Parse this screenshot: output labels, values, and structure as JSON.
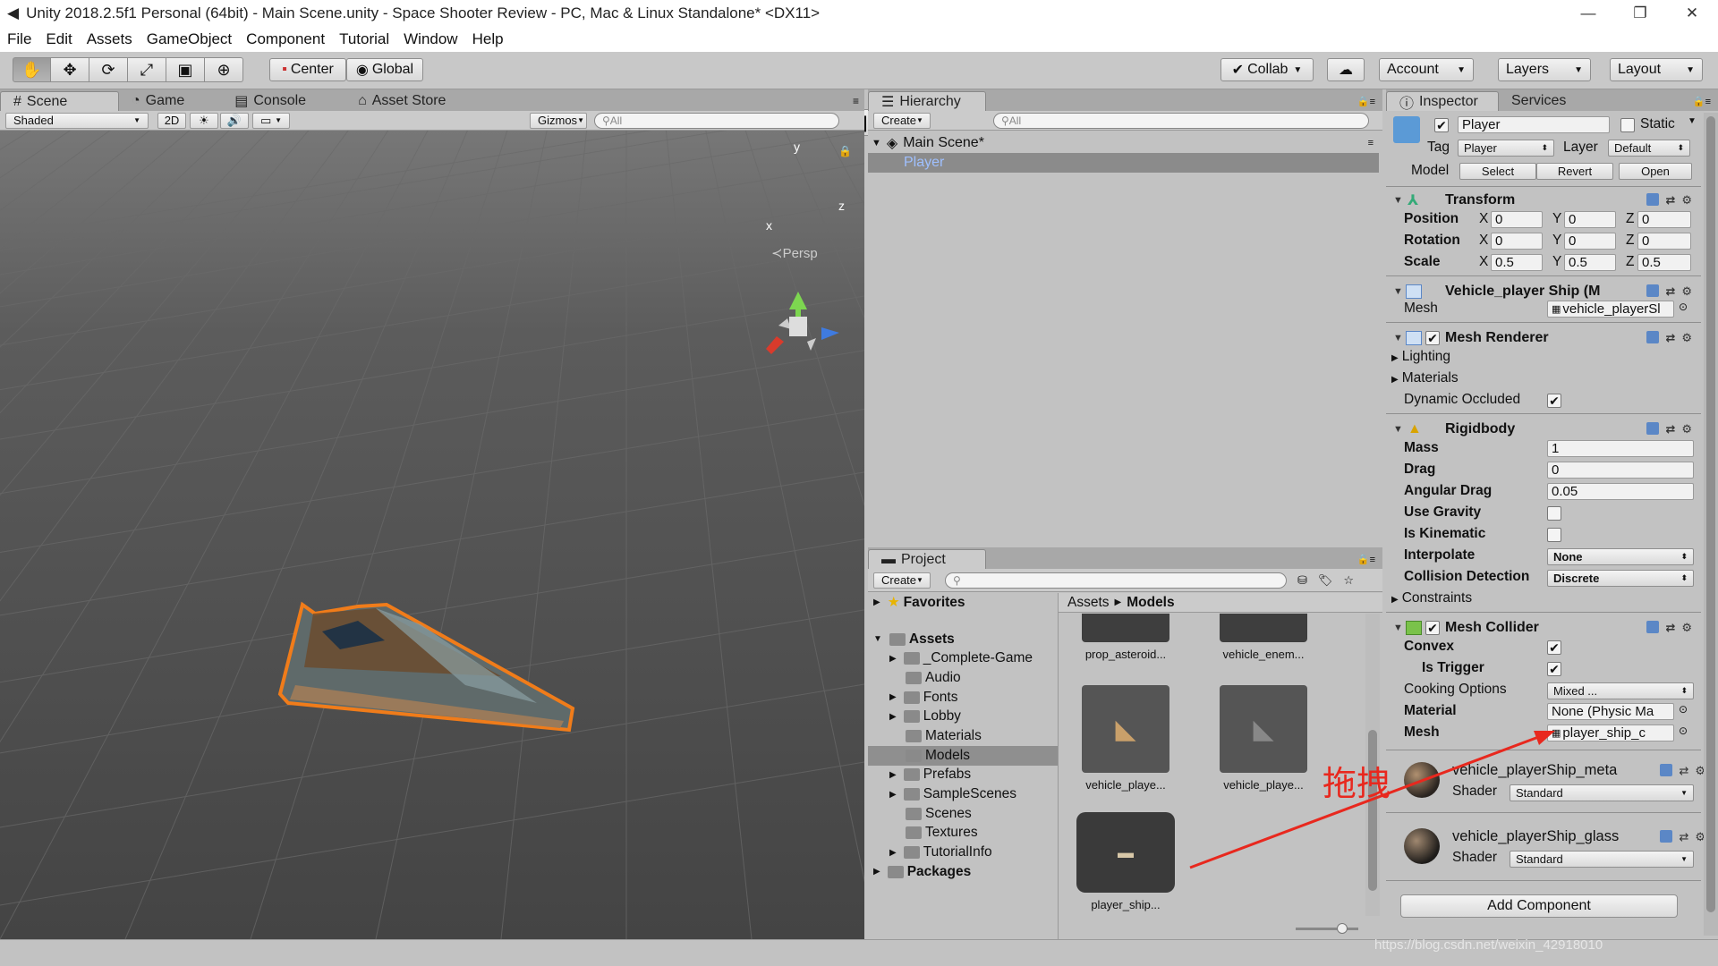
{
  "window": {
    "title": "Unity 2018.2.5f1 Personal (64bit) - Main Scene.unity - Space Shooter Review - PC, Mac & Linux Standalone* <DX11>",
    "controls": [
      "—",
      "❐",
      "✕"
    ]
  },
  "menu": [
    "File",
    "Edit",
    "Assets",
    "GameObject",
    "Component",
    "Tutorial",
    "Window",
    "Help"
  ],
  "toolbar": {
    "pivot": "Center",
    "space": "Global",
    "collab": "Collab",
    "account": "Account",
    "layers": "Layers",
    "layout": "Layout"
  },
  "scene": {
    "tabs": [
      "Scene",
      "Game",
      "Console",
      "Asset Store"
    ],
    "shading": "Shaded",
    "mode_2d": "2D",
    "gizmos": "Gizmos",
    "search_placeholder": "All",
    "gizmo_labels": {
      "y": "y",
      "x": "x",
      "z": "z"
    },
    "persp": "Persp"
  },
  "hierarchy": {
    "tab": "Hierarchy",
    "create": "Create",
    "search_placeholder": "All",
    "scene_name": "Main Scene*",
    "items": [
      "Player"
    ]
  },
  "project": {
    "tab": "Project",
    "create": "Create",
    "favorites": "Favorites",
    "assets_root": "Assets",
    "folders": [
      "_Complete-Game",
      "Audio",
      "Fonts",
      "Lobby",
      "Materials",
      "Models",
      "Prefabs",
      "SampleScenes",
      "Scenes",
      "Textures",
      "TutorialInfo"
    ],
    "packages": "Packages",
    "breadcrumb": [
      "Assets",
      "Models"
    ],
    "assets": [
      "prop_asteroid...",
      "vehicle_enem...",
      "vehicle_playe...",
      "vehicle_playe...",
      "player_ship..."
    ]
  },
  "inspector": {
    "tabs": [
      "Inspector",
      "Services"
    ],
    "object_name": "Player",
    "static_label": "Static",
    "tag_label": "Tag",
    "tag_value": "Player",
    "layer_label": "Layer",
    "layer_value": "Default",
    "model_label": "Model",
    "model_buttons": [
      "Select",
      "Revert",
      "Open"
    ],
    "transform": {
      "title": "Transform",
      "rows": [
        {
          "label": "Position",
          "x": "0",
          "y": "0",
          "z": "0"
        },
        {
          "label": "Rotation",
          "x": "0",
          "y": "0",
          "z": "0"
        },
        {
          "label": "Scale",
          "x": "0.5",
          "y": "0.5",
          "z": "0.5"
        }
      ]
    },
    "mesh_filter": {
      "title": "Vehicle_player Ship (M",
      "mesh_label": "Mesh",
      "mesh_value": "vehicle_playerSl"
    },
    "mesh_renderer": {
      "title": "Mesh Renderer",
      "lighting": "Lighting",
      "materials": "Materials",
      "dynamic_occluded": "Dynamic Occluded"
    },
    "rigidbody": {
      "title": "Rigidbody",
      "mass_label": "Mass",
      "mass": "1",
      "drag_label": "Drag",
      "drag": "0",
      "angular_label": "Angular Drag",
      "angular": "0.05",
      "gravity_label": "Use Gravity",
      "kinematic_label": "Is Kinematic",
      "interpolate_label": "Interpolate",
      "interpolate": "None",
      "collision_label": "Collision Detection",
      "collision": "Discrete",
      "constraints": "Constraints"
    },
    "mesh_collider": {
      "title": "Mesh Collider",
      "convex_label": "Convex",
      "trigger_label": "Is Trigger",
      "cooking_label": "Cooking Options",
      "cooking": "Mixed ...",
      "material_label": "Material",
      "material": "None (Physic Ma",
      "mesh_label": "Mesh",
      "mesh": "player_ship_c"
    },
    "materials": [
      {
        "name": "vehicle_playerShip_meta",
        "shader_label": "Shader",
        "shader": "Standard"
      },
      {
        "name": "vehicle_playerShip_glass",
        "shader_label": "Shader",
        "shader": "Standard"
      }
    ],
    "add_component": "Add Component"
  },
  "annotation": {
    "text": "拖拽",
    "color": "#e8281e"
  },
  "watermark": "https://blog.csdn.net/weixin_42918010",
  "colors": {
    "selection": "#3d6fbf",
    "ship_outline": "#f07c1a"
  }
}
